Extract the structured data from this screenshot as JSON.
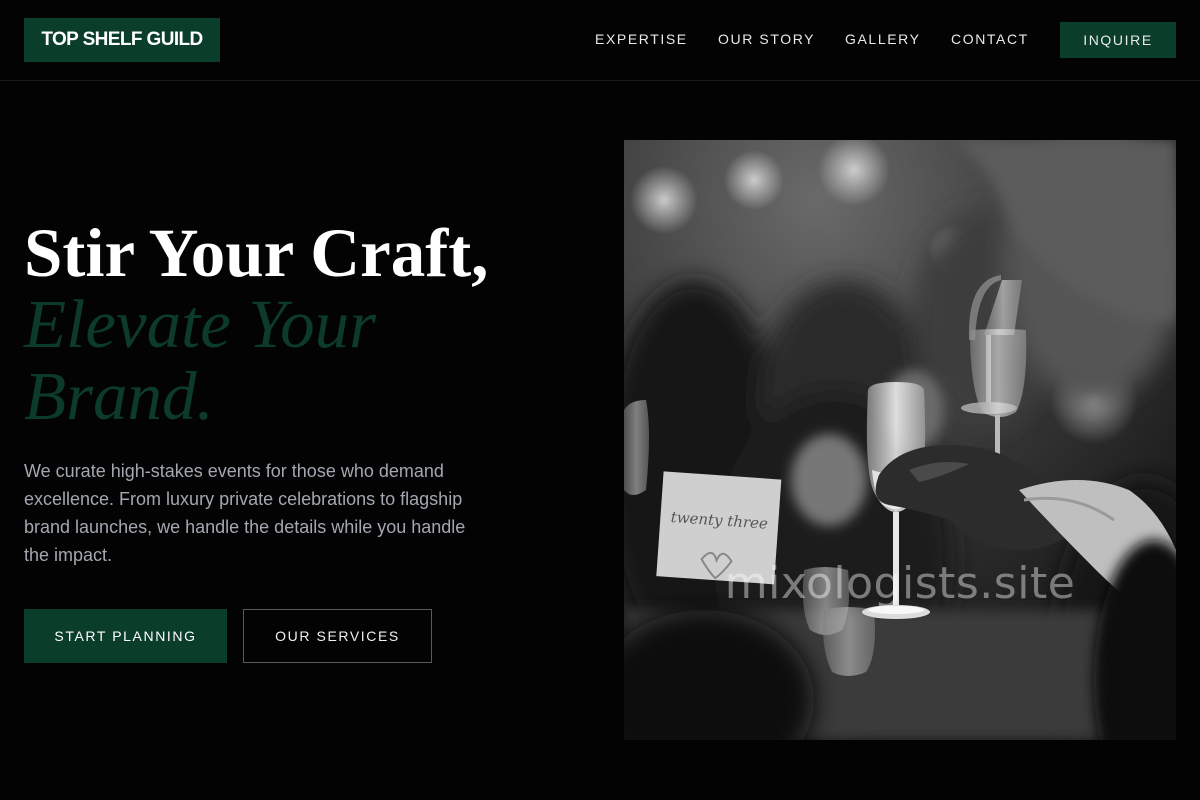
{
  "header": {
    "logo": "TOP SHELF GUILD",
    "nav": [
      "EXPERTISE",
      "OUR STORY",
      "GALLERY",
      "CONTACT"
    ],
    "cta": "INQUIRE"
  },
  "hero": {
    "headline_line1": "Stir Your Craft,",
    "headline_line2": "Elevate Your",
    "headline_line3": "Brand.",
    "lead": "We curate high-stakes events for those who demand excellence. From luxury private celebrations to flagship brand launches, we handle the details while you handle the impact.",
    "primary_button": "START PLANNING",
    "secondary_button": "OUR SERVICES"
  },
  "photo": {
    "watermark": "mixologists.site",
    "table_card": "twenty three"
  },
  "colors": {
    "background": "#030303",
    "brand_green": "#0b3d2b",
    "headline_accent": "#0d3b2a",
    "lead_text": "#a3a8b0"
  }
}
